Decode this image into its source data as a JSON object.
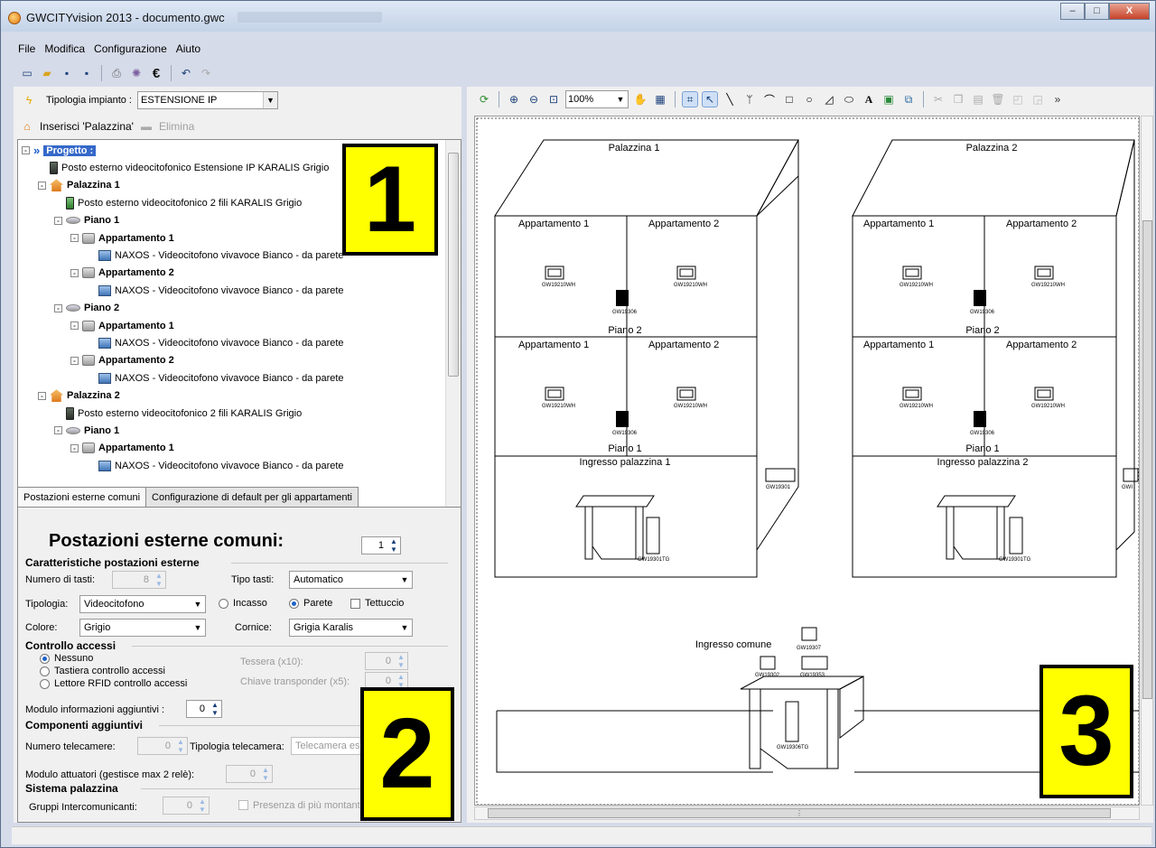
{
  "window": {
    "title": "GWCITYvision 2013 - documento.gwc",
    "min": "–",
    "max": "□",
    "close": "X"
  },
  "menu": [
    "File",
    "Modifica",
    "Configurazione",
    "Aiuto"
  ],
  "tipologia": {
    "label": "Tipologia impianto :",
    "value": "ESTENSIONE IP"
  },
  "insert": {
    "add_label": "Inserisci 'Palazzina'",
    "delete_label": "Elimina"
  },
  "tree": [
    {
      "label": "Progetto :",
      "icon": "double-chevron",
      "level": 0,
      "bold": true,
      "exp": "-",
      "selected": true
    },
    {
      "label": "Posto esterno videocitofonico Estensione IP KARALIS Grigio",
      "icon": "device",
      "level": 1
    },
    {
      "label": "Palazzina 1",
      "icon": "house",
      "level": 1,
      "bold": true,
      "exp": "-"
    },
    {
      "label": "Posto esterno videocitofonico 2 fili KARALIS Grigio",
      "icon": "device-green",
      "level": 2
    },
    {
      "label": "Piano 1",
      "icon": "floor",
      "level": 2,
      "bold": true,
      "exp": "-"
    },
    {
      "label": "Appartamento 1",
      "icon": "apartment",
      "level": 3,
      "bold": true,
      "exp": "-"
    },
    {
      "label": "NAXOS - Videocitofono vivavoce Bianco - da parete",
      "icon": "monitor",
      "level": 4
    },
    {
      "label": "Appartamento 2",
      "icon": "apartment",
      "level": 3,
      "bold": true,
      "exp": "-"
    },
    {
      "label": "NAXOS - Videocitofono vivavoce Bianco - da parete",
      "icon": "monitor",
      "level": 4
    },
    {
      "label": "Piano 2",
      "icon": "floor",
      "level": 2,
      "bold": true,
      "exp": "-"
    },
    {
      "label": "Appartamento 1",
      "icon": "apartment",
      "level": 3,
      "bold": true,
      "exp": "-"
    },
    {
      "label": "NAXOS - Videocitofono vivavoce Bianco - da parete",
      "icon": "monitor",
      "level": 4
    },
    {
      "label": "Appartamento 2",
      "icon": "apartment",
      "level": 3,
      "bold": true,
      "exp": "-"
    },
    {
      "label": "NAXOS - Videocitofono vivavoce Bianco - da parete",
      "icon": "monitor",
      "level": 4
    },
    {
      "label": "Palazzina 2",
      "icon": "house",
      "level": 1,
      "bold": true,
      "exp": "-"
    },
    {
      "label": "Posto esterno videocitofonico 2 fili KARALIS Grigio",
      "icon": "device",
      "level": 2
    },
    {
      "label": "Piano 1",
      "icon": "floor",
      "level": 2,
      "bold": true,
      "exp": "-"
    },
    {
      "label": "Appartamento 1",
      "icon": "apartment",
      "level": 3,
      "bold": true,
      "exp": "-"
    },
    {
      "label": "NAXOS - Videocitofono vivavoce Bianco - da parete",
      "icon": "monitor",
      "level": 4
    }
  ],
  "tabs": [
    "Postazioni esterne comuni",
    "Configurazione di default per gli appartamenti"
  ],
  "props": {
    "title": "Postazioni esterne comuni:",
    "count": "1",
    "sec_caratteristiche": "Caratteristiche postazioni esterne",
    "numero_tasti_label": "Numero di tasti:",
    "numero_tasti": "8",
    "tipo_tasti_label": "Tipo tasti:",
    "tipo_tasti": "Automatico",
    "tipologia_label": "Tipologia:",
    "tipologia": "Videocitofono",
    "incasso": "Incasso",
    "parete": "Parete",
    "tettuccio": "Tettuccio",
    "colore_label": "Colore:",
    "colore": "Grigio",
    "cornice_label": "Cornice:",
    "cornice": "Grigia Karalis",
    "sec_controllo": "Controllo accessi",
    "nessuno": "Nessuno",
    "tastiera": "Tastiera controllo accessi",
    "lettore": "Lettore RFID controllo accessi",
    "tessera_label": "Tessera (x10):",
    "tessera": "0",
    "chiave_label": "Chiave transponder (x5):",
    "chiave": "0",
    "modulo_info_label": "Modulo informazioni aggiuntivi :",
    "modulo_info": "0",
    "sec_componenti": "Componenti aggiuntivi",
    "numero_tel_label": "Numero telecamere:",
    "numero_tel": "0",
    "tipologia_tel_label": "Tipologia telecamera:",
    "tipologia_tel": "Telecamera es",
    "modulo_att_label": "Modulo attuatori (gestisce max 2 relè):",
    "modulo_att": "0",
    "sec_sistema": "Sistema palazzina",
    "gruppi_label": "Gruppi Intercomunicanti:",
    "gruppi": "0",
    "presenza": "Presenza di più montanti"
  },
  "zoom": "100%",
  "drawing": {
    "palazzina1": "Palazzina 1",
    "palazzina2": "Palazzina 2",
    "app1": "Appartamento 1",
    "app2": "Appartamento 2",
    "piano2": "Piano 2",
    "piano1": "Piano 1",
    "ingresso1": "Ingresso palazzina 1",
    "ingresso2": "Ingresso palazzina 2",
    "ingresso_comune": "Ingresso comune",
    "code_monitor": "GW19210WH",
    "code_unit": "GW19306",
    "code_post": "GW19301",
    "code_panel": "GW19301TG",
    "code_gwi": "GWI",
    "code_common1": "GW19307",
    "code_common2": "GW19302",
    "code_common3": "GW19353",
    "code_common4": "GW19306TG"
  },
  "badges": [
    "1",
    "2",
    "3"
  ],
  "colors": {
    "badge": "#ffff00",
    "selection": "#3568c9"
  }
}
